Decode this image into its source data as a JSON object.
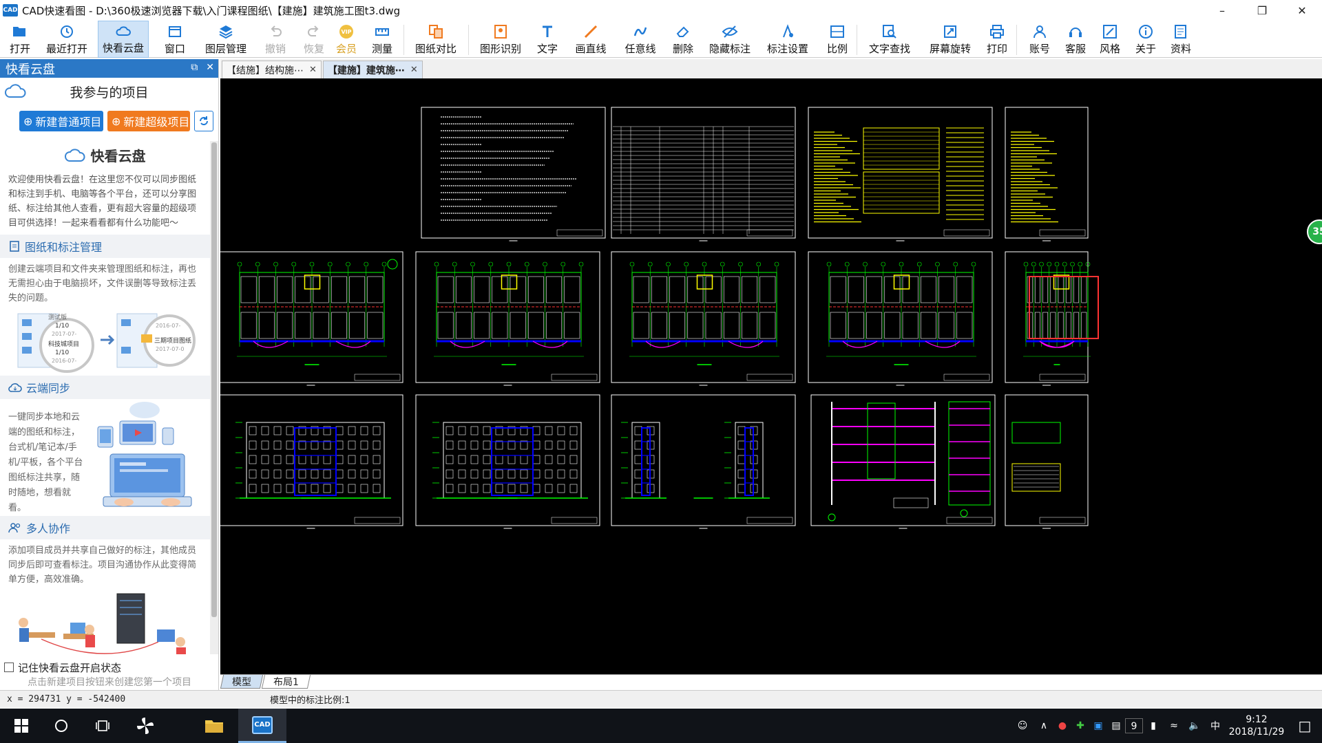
{
  "window": {
    "title": "CAD快速看图 - D:\\360极速浏览器下载\\入门课程图纸\\【建施】建筑施工图t3.dwg",
    "logo_text": "CAD"
  },
  "toolbar": {
    "items": [
      {
        "label": "打开",
        "icon": "folder-open-icon"
      },
      {
        "label": "最近打开",
        "icon": "history-icon"
      },
      {
        "label": "快看云盘",
        "icon": "cloud-icon"
      },
      {
        "label": "窗口",
        "icon": "window-icon"
      },
      {
        "label": "图层管理",
        "icon": "layers-icon"
      },
      {
        "label": "撤销",
        "icon": "undo-icon"
      },
      {
        "label": "恢复",
        "icon": "redo-icon"
      },
      {
        "label": "会员",
        "icon": "vip-icon"
      },
      {
        "label": "测量",
        "icon": "ruler-icon"
      },
      {
        "label": "图纸对比",
        "icon": "compare-icon"
      },
      {
        "label": "图形识别",
        "icon": "recognize-icon"
      },
      {
        "label": "文字",
        "icon": "text-icon"
      },
      {
        "label": "画直线",
        "icon": "line-icon"
      },
      {
        "label": "任意线",
        "icon": "freehand-icon"
      },
      {
        "label": "删除",
        "icon": "eraser-icon"
      },
      {
        "label": "隐藏标注",
        "icon": "hide-icon"
      },
      {
        "label": "标注设置",
        "icon": "annot-settings-icon"
      },
      {
        "label": "比例",
        "icon": "scale-icon"
      },
      {
        "label": "文字查找",
        "icon": "text-search-icon"
      },
      {
        "label": "屏幕旋转",
        "icon": "rotate-icon"
      },
      {
        "label": "打印",
        "icon": "printer-icon"
      },
      {
        "label": "账号",
        "icon": "user-icon"
      },
      {
        "label": "客服",
        "icon": "headset-icon"
      },
      {
        "label": "风格",
        "icon": "style-icon"
      },
      {
        "label": "关于",
        "icon": "info-icon"
      },
      {
        "label": "资料",
        "icon": "docs-icon"
      }
    ],
    "vip_badge": "VIP"
  },
  "left_panel": {
    "header": "快看云盘",
    "projects_title": "我参与的项目",
    "btn_new_normal": "新建普通项目",
    "btn_new_super": "新建超级项目",
    "card_title": "快看云盘",
    "intro": "欢迎使用快看云盘！在这里您不仅可以同步图纸和标注到手机、电脑等各个平台，还可以分享图纸、标注给其他人查看，更有超大容量的超级项目可供选择！一起来看看都有什么功能吧～",
    "sec1_title": "图纸和标注管理",
    "sec1_body": "创建云端项目和文件夹来管理图纸和标注，再也无需担心由于电脑损坏，文件误删等导致标注丢失的问题。",
    "sec1_illus": {
      "a1": "测试版",
      "a2": "1/10",
      "a3": "2017-07-",
      "a4": "科技城项目",
      "a5": "1/10",
      "a6": "2016-07-",
      "b1": "2016-07-",
      "b2": "三期项目图纸",
      "b3": "2017-07-0"
    },
    "sec2_title": "云端同步",
    "sec2_body": "一键同步本地和云端的图纸和标注，台式机/笔记本/手机/平板，各个平台图纸标注共享，随时随地，想看就看。",
    "sec3_title": "多人协作",
    "sec3_body": "添加项目成员并共享自己做好的标注，其他成员同步后即可查看标注。项目沟通协作从此变得简单方便，高效准确。",
    "remember": "记住快看云盘开启状态",
    "hint": "点击新建项目按钮来创建您第一个项目"
  },
  "doc_tabs": [
    {
      "label": "【结施】结构施⋯",
      "active": false
    },
    {
      "label": "【建施】建筑施⋯",
      "active": true
    }
  ],
  "canvas": {
    "badge": "35"
  },
  "layout_tabs": [
    "模型",
    "布局1"
  ],
  "status": {
    "coords": "x = 294731  y = -542400",
    "scale": "模型中的标注比例:1"
  },
  "taskbar": {
    "time": "9:12",
    "date": "2018/11/29",
    "ime": "中",
    "badge": "9"
  },
  "colors": {
    "accent": "#2b78c6",
    "orange": "#f07a1f",
    "cad_green": "#00ff00",
    "cad_yellow": "#ffff00",
    "cad_blue": "#0000ff",
    "cad_magenta": "#ff00ff"
  }
}
